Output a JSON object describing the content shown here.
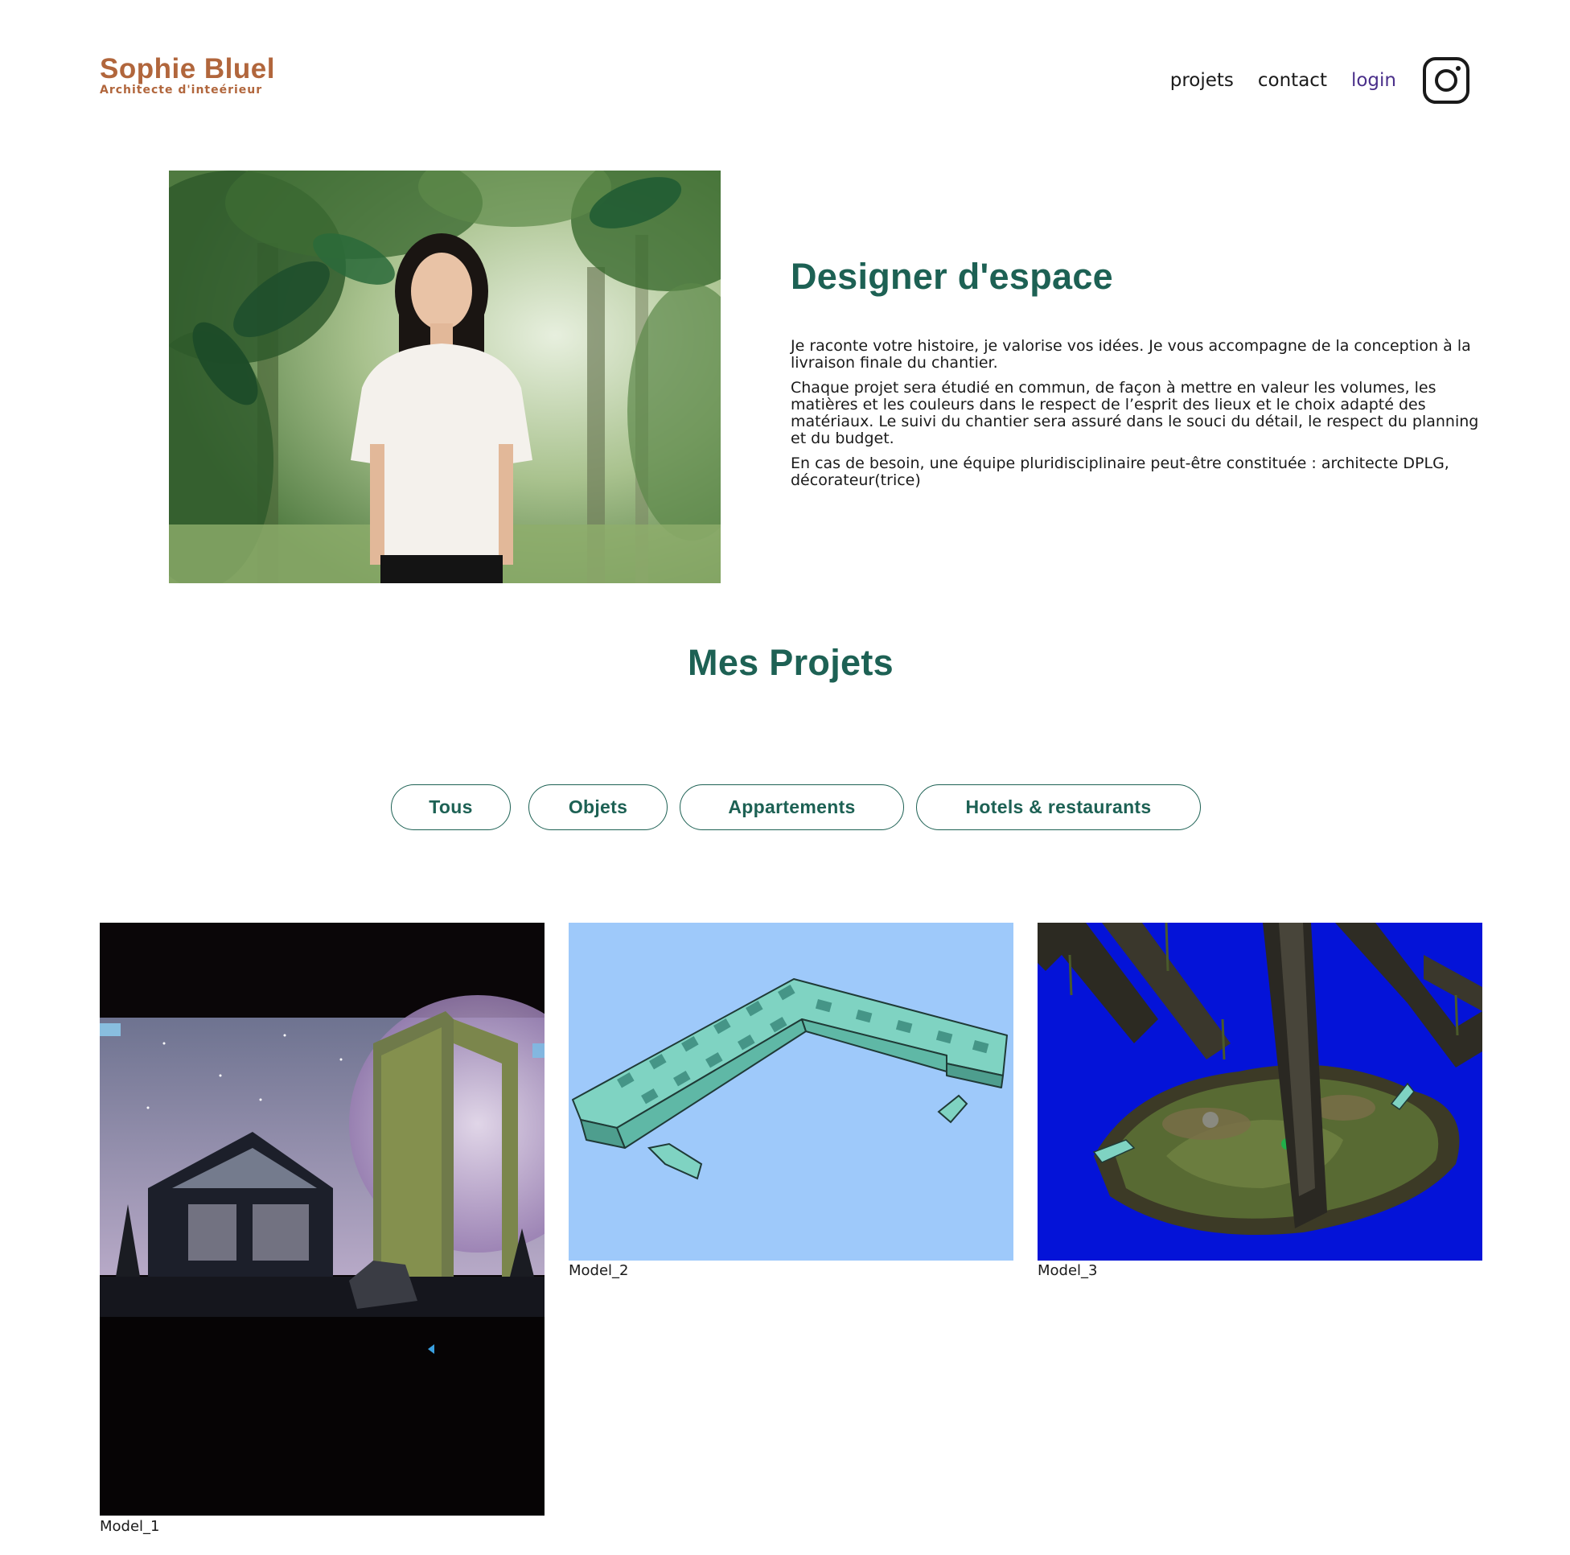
{
  "header": {
    "brand_name": "Sophie Bluel",
    "brand_subtitle": "Architecte d'inteérieur",
    "nav": {
      "projets": "projets",
      "contact": "contact",
      "login": "login"
    },
    "social_icon": "instagram-icon"
  },
  "intro": {
    "title": "Designer d'espace",
    "paragraphs": [
      "Je raconte votre histoire, je valorise vos idées. Je vous accompagne de la conception à la livraison finale du chantier.",
      "Chaque projet sera étudié en commun, de façon à mettre en valeur les volumes, les matières et les couleurs dans le respect de l’esprit des lieux et le choix adapté des matériaux. Le suivi du chantier sera assuré dans le souci du détail, le respect du planning et du budget.",
      "En cas de besoin, une équipe pluridisciplinaire peut-être constituée : architecte DPLG, décorateur(trice)"
    ]
  },
  "projects": {
    "title": "Mes Projets",
    "filters": [
      "Tous",
      "Objets",
      "Appartements",
      "Hotels & restaurants"
    ],
    "items": [
      {
        "caption": "Model_1"
      },
      {
        "caption": "Model_2"
      },
      {
        "caption": "Model_3"
      }
    ]
  },
  "colors": {
    "brand": "#b1663c",
    "accent": "#1d6154",
    "login": "#4a2f8a"
  }
}
